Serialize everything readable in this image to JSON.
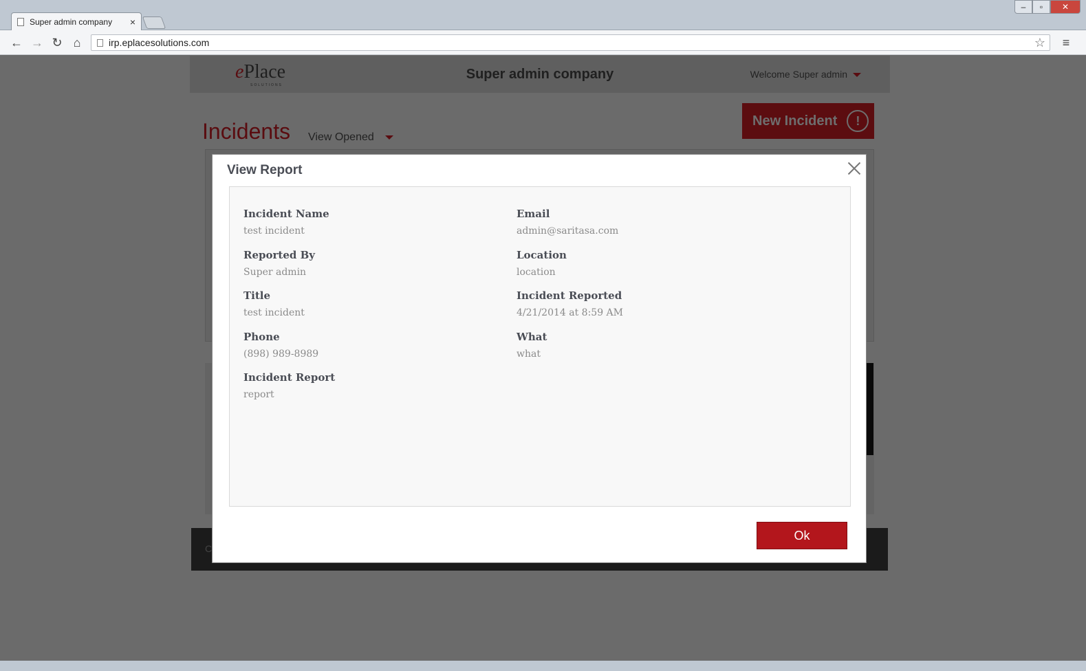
{
  "browser": {
    "tab_title": "Super admin company",
    "tab_close": "×",
    "url": "irp.eplacesolutions.com",
    "back": "←",
    "forward": "→",
    "reload": "↻",
    "home": "⌂",
    "star": "☆",
    "menu": "≡",
    "win_min": "–",
    "win_max": "▫",
    "win_close": "✕"
  },
  "header": {
    "logo_e": "e",
    "logo_rest": "Place",
    "logo_sub": "SOLUTIONS",
    "company": "Super admin company",
    "welcome": "Welcome Super admin"
  },
  "page": {
    "title": "Incidents",
    "view_filter": "View Opened",
    "new_incident": "New Incident",
    "new_incident_icon": "!",
    "footer_char": "C"
  },
  "modal": {
    "title": "View Report",
    "ok_label": "Ok",
    "fields": {
      "incident_name": {
        "label": "Incident Name",
        "value": "test incident"
      },
      "reported_by": {
        "label": "Reported By",
        "value": "Super admin"
      },
      "title": {
        "label": "Title",
        "value": "test incident"
      },
      "phone": {
        "label": "Phone",
        "value": "(898) 989-8989"
      },
      "incident_report": {
        "label": "Incident Report",
        "value": "report"
      },
      "email": {
        "label": "Email",
        "value": "admin@saritasa.com"
      },
      "location": {
        "label": "Location",
        "value": "location"
      },
      "incident_reported": {
        "label": "Incident Reported",
        "value": "4/21/2014 at 8:59 AM"
      },
      "what": {
        "label": "What",
        "value": "what"
      }
    }
  },
  "colors": {
    "brand_red": "#b3161c",
    "title_red_dimmed": "#5a0c10",
    "overlay": "#6b6b6b"
  }
}
